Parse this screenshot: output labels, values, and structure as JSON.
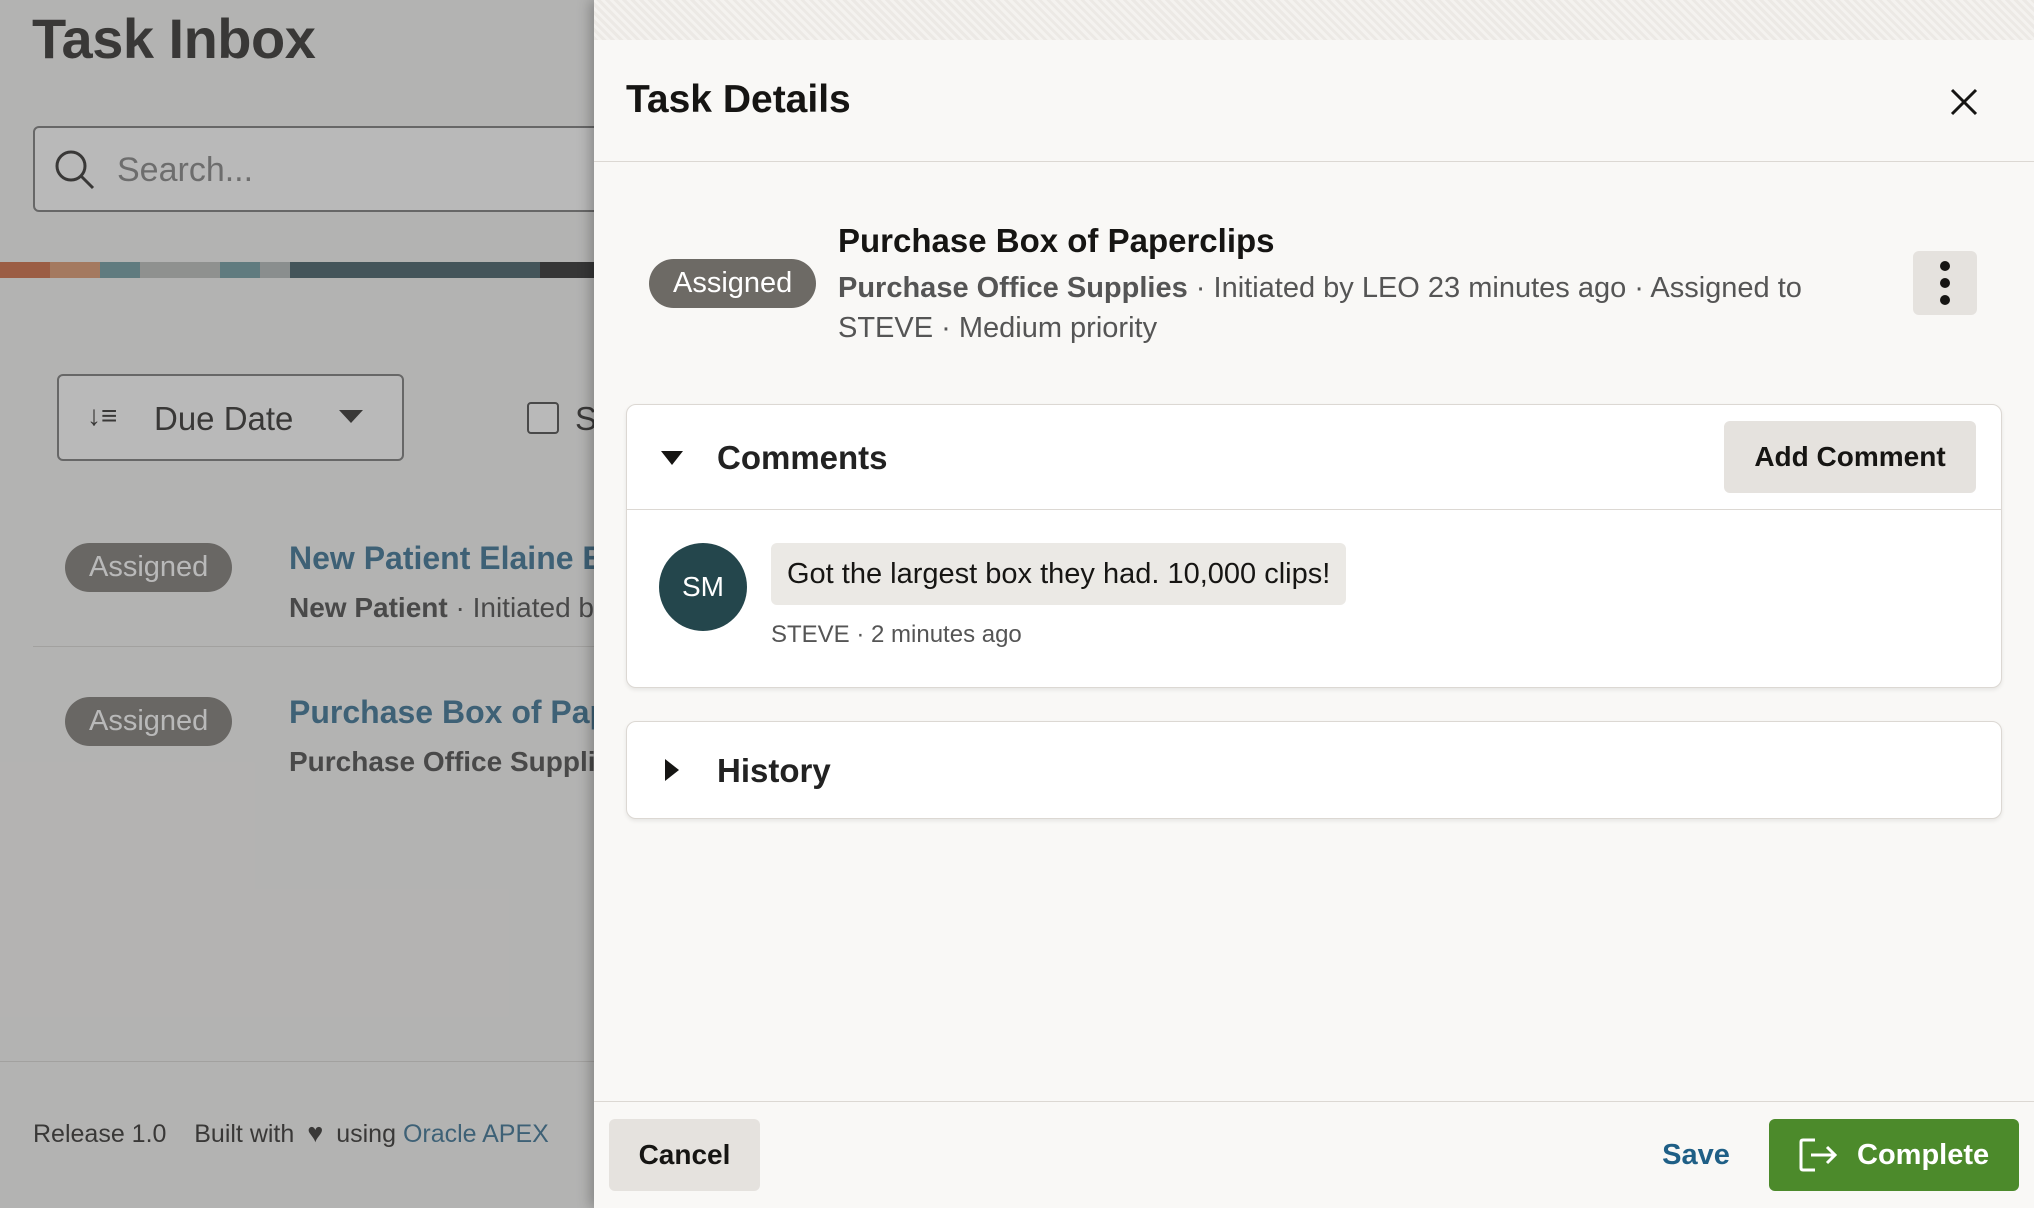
{
  "background": {
    "page_title": "Task Inbox",
    "search": {
      "placeholder": "Search..."
    },
    "sort": {
      "label": "Due Date"
    },
    "checkbox_label": "S",
    "tasks": [
      {
        "status": "Assigned",
        "title": "New Patient Elaine E",
        "type": "New Patient",
        "info": " · Initiated b"
      },
      {
        "status": "Assigned",
        "title": "Purchase Box of Pap",
        "type": "Purchase Office Suppli",
        "info": ""
      }
    ],
    "footer": {
      "release": "Release 1.0",
      "built_with": "Built with",
      "using": "using",
      "link": "Oracle APEX"
    }
  },
  "drawer": {
    "title": "Task Details",
    "task": {
      "status": "Assigned",
      "title": "Purchase Box of Paperclips",
      "type": "Purchase Office Supplies",
      "details": " · Initiated by LEO 23 minutes ago · Assigned to STEVE · Medium priority"
    },
    "comments": {
      "title": "Comments",
      "add_label": "Add Comment",
      "items": [
        {
          "initials": "SM",
          "text": "Got the largest box they had. 10,000 clips!",
          "meta": "STEVE · 2 minutes ago"
        }
      ]
    },
    "history": {
      "title": "History"
    },
    "footer": {
      "cancel": "Cancel",
      "save": "Save",
      "complete": "Complete"
    }
  },
  "colors": {
    "accent": "#4c8a2b",
    "link": "#1f5f86",
    "badge": "#6d6a65",
    "avatar": "#24464c"
  }
}
